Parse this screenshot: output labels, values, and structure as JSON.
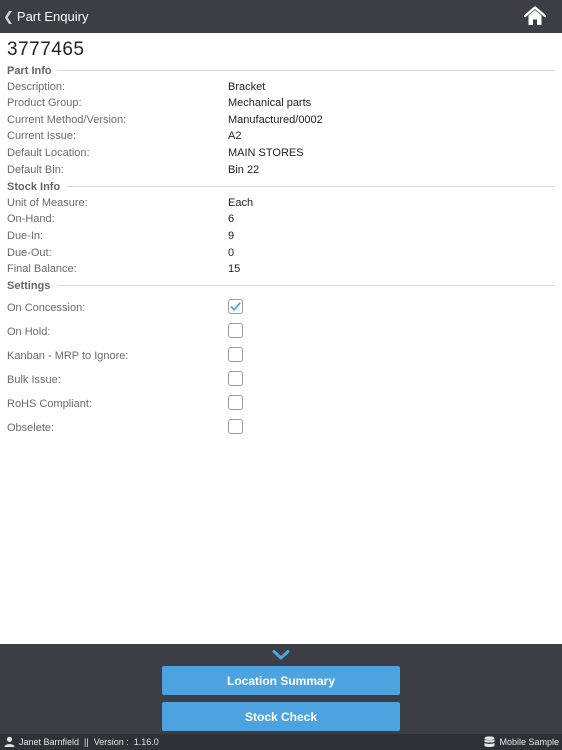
{
  "header": {
    "back_label": "Part Enquiry",
    "back_icon": "chevron-left-icon",
    "home_icon": "home-icon"
  },
  "part": {
    "number": "3777465"
  },
  "part_info": {
    "title": "Part Info",
    "rows": [
      {
        "label": "Description:",
        "value": "Bracket"
      },
      {
        "label": "Product Group:",
        "value": "Mechanical parts"
      },
      {
        "label": "Current Method/Version:",
        "value": "Manufactured/0002"
      },
      {
        "label": "Current Issue:",
        "value": "A2"
      },
      {
        "label": "Default Location:",
        "value": "MAIN STORES"
      },
      {
        "label": "Default Bin:",
        "value": "Bin 22"
      }
    ]
  },
  "stock_info": {
    "title": "Stock Info",
    "rows": [
      {
        "label": "Unit of Measure:",
        "value": "Each"
      },
      {
        "label": "On-Hand:",
        "value": "6"
      },
      {
        "label": "Due-In:",
        "value": "9"
      },
      {
        "label": "Due-Out:",
        "value": "0"
      },
      {
        "label": "Final Balance:",
        "value": "15"
      }
    ]
  },
  "settings": {
    "title": "Settings",
    "rows": [
      {
        "label": "On Concession:",
        "checked": true
      },
      {
        "label": "On Hold:",
        "checked": false
      },
      {
        "label": "Kanban - MRP to Ignore:",
        "checked": false
      },
      {
        "label": "Bulk Issue:",
        "checked": false
      },
      {
        "label": "RoHS Compliant:",
        "checked": false
      },
      {
        "label": "Obselete:",
        "checked": false
      }
    ]
  },
  "actions": {
    "collapse_icon": "chevron-down-icon",
    "location_summary": "Location Summary",
    "stock_check": "Stock Check"
  },
  "status": {
    "user_icon": "user-icon",
    "user_text": "Janet Barnfield  ||  Version :  1.16.0",
    "db_icon": "database-icon",
    "db_text": "Mobile Sample"
  },
  "colors": {
    "header_bg": "#3b3e45",
    "button_bg": "#4da3e0",
    "check_color": "#4da3e0",
    "status_bg": "#2f3137"
  }
}
